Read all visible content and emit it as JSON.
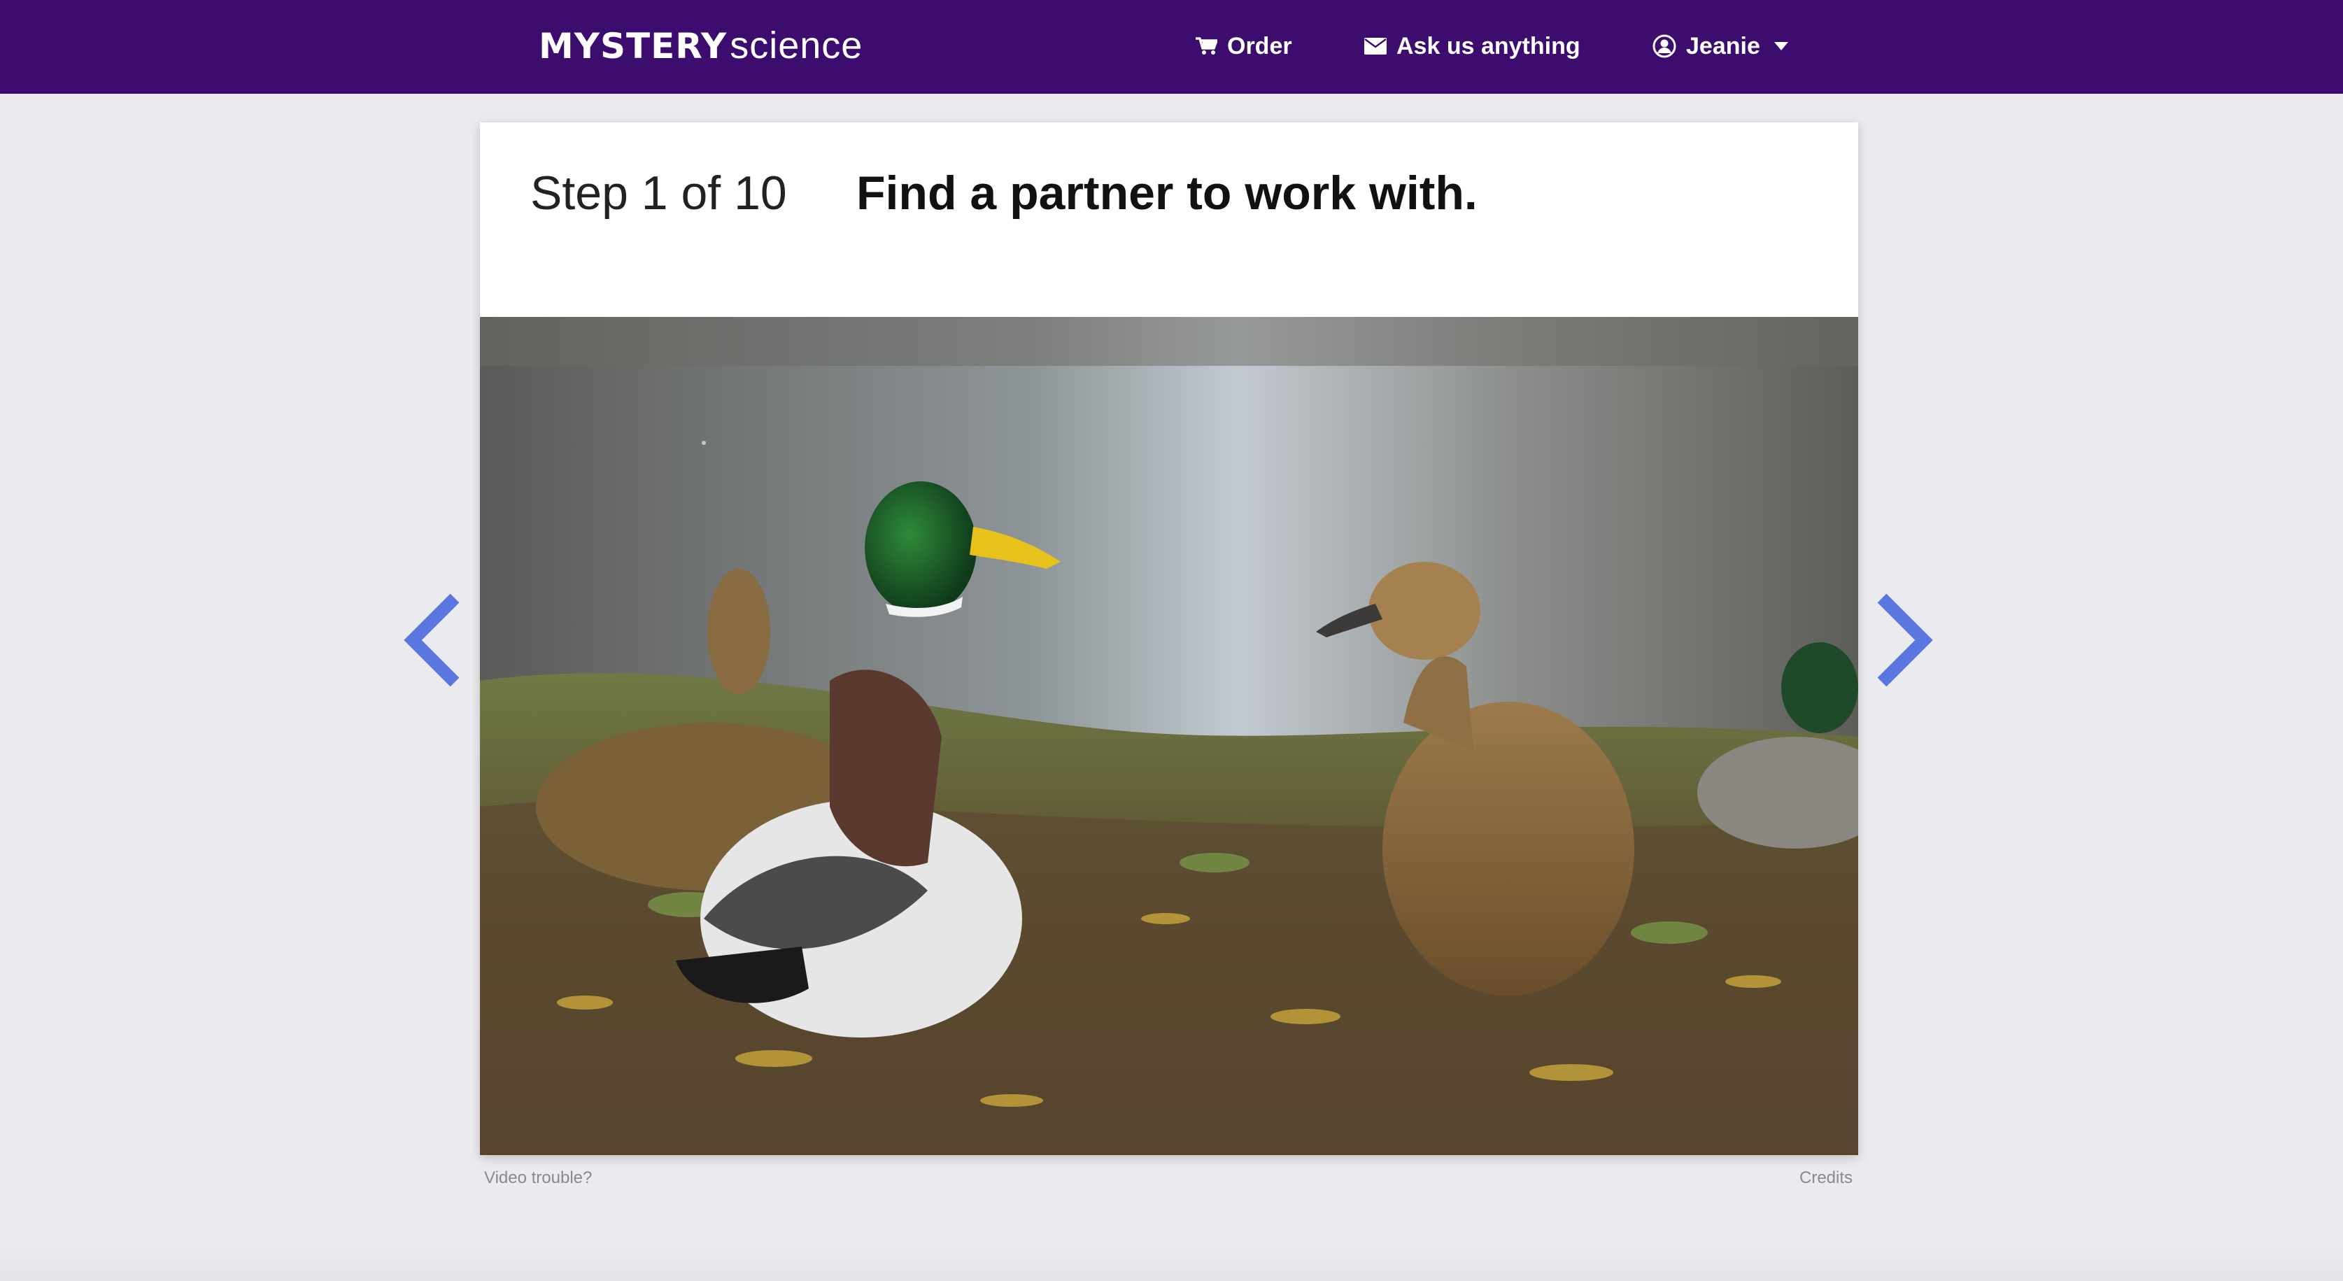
{
  "header": {
    "logo_bold": "MYSTERY",
    "logo_light": "science",
    "nav": {
      "order_label": "Order",
      "ask_label": "Ask us anything",
      "user_label": "Jeanie"
    },
    "icons": [
      "cart-icon",
      "envelope-icon",
      "user-circle-icon",
      "caret-down-icon"
    ],
    "background_color": "#3c0d6e"
  },
  "step": {
    "counter": "Step 1 of 10",
    "instruction": "Find a partner to work with."
  },
  "media": {
    "icons": [
      "duck-photo"
    ]
  },
  "footer": {
    "video_trouble": "Video trouble?",
    "credits": "Credits"
  },
  "navigation": {
    "icons": [
      "chevron-left-icon",
      "chevron-right-icon"
    ],
    "arrow_color": "#5a76e0"
  }
}
